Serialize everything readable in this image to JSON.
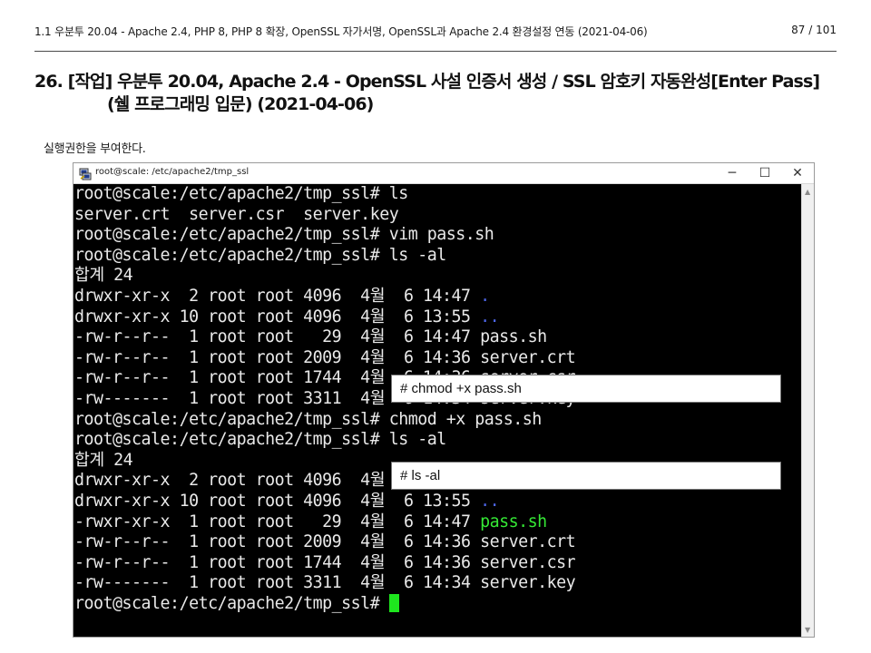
{
  "header": {
    "title": "1.1 우분투 20.04 - Apache 2.4, PHP 8, PHP 8 확장, OpenSSL 자가서명, OpenSSL과 Apache 2.4 환경설정 연동 (2021-04-06)",
    "page": "87 / 101"
  },
  "section": {
    "title_line1": "26. [작업] 우분투 20.04, Apache 2.4 - OpenSSL 사설 인증서 생성 / SSL 암호키 자동완성[Enter Pass]",
    "title_line2": "(쉘 프로그래밍 입문) (2021-04-06)",
    "body": "실행권한을 부여한다."
  },
  "window": {
    "title": "root@scale: /etc/apache2/tmp_ssl",
    "icon": "putty-icon",
    "controls": {
      "minimize": "─",
      "maximize": "☐",
      "close": "✕"
    }
  },
  "terminal": {
    "lines": [
      "root@scale:/etc/apache2/tmp_ssl# ls",
      "server.crt  server.csr  server.key",
      "root@scale:/etc/apache2/tmp_ssl# vim pass.sh",
      "root@scale:/etc/apache2/tmp_ssl# ls -al",
      "합계 24",
      "drwxr-xr-x  2 root root 4096  4월  6 14:47 ",
      "drwxr-xr-x 10 root root 4096  4월  6 13:55 ",
      "-rw-r--r--  1 root root   29  4월  6 14:47 pass.sh",
      "-rw-r--r--  1 root root 2009  4월  6 14:36 server.crt",
      "-rw-r--r--  1 root root 1744  4월  6 14:36 server.csr",
      "-rw-------  1 root root 3311  4월  6 14:34 server.key",
      "root@scale:/etc/apache2/tmp_ssl# chmod +x pass.sh",
      "root@scale:/etc/apache2/tmp_ssl# ls -al",
      "합계 24",
      "drwxr-xr-x  2 root root 4096  4월  6 14:47 ",
      "drwxr-xr-x 10 root root 4096  4월  6 13:55 ",
      "-rwxr-xr-x  1 root root   29  4월  6 14:47 ",
      "-rw-r--r--  1 root root 2009  4월  6 14:36 server.crt",
      "-rw-r--r--  1 root root 1744  4월  6 14:36 server.csr",
      "-rw-------  1 root root 3311  4월  6 14:34 server.key",
      "root@scale:/etc/apache2/tmp_ssl# "
    ],
    "dir_dot": ".",
    "dir_dotdot": "..",
    "exe_name": "pass.sh",
    "colors": {
      "background": "#000000",
      "text": "#e9e9e9",
      "directory": "#4d66e8",
      "executable": "#35e835",
      "cursor": "#1ee61e"
    }
  },
  "callouts": {
    "first": "# chmod +x pass.sh",
    "second": "# ls -al"
  }
}
